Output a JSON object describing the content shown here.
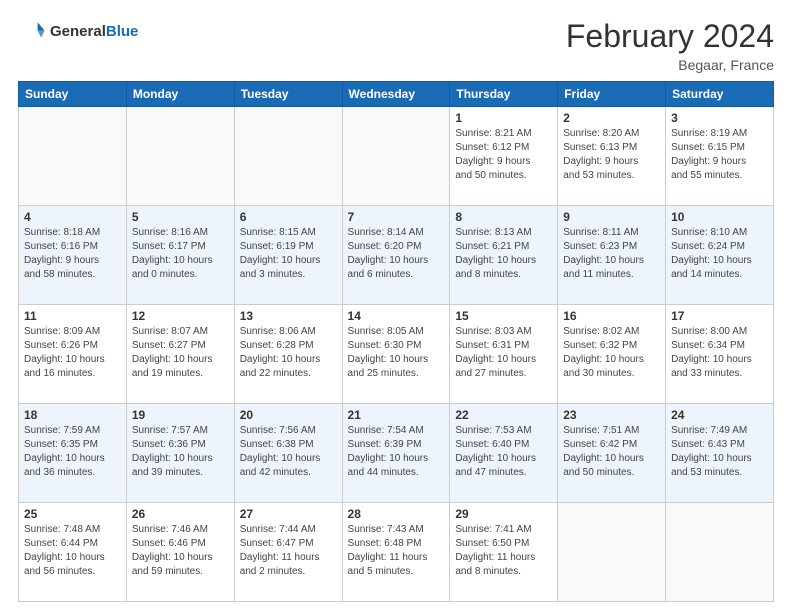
{
  "header": {
    "logo_general": "General",
    "logo_blue": "Blue",
    "month_title": "February 2024",
    "location": "Begaar, France"
  },
  "days_of_week": [
    "Sunday",
    "Monday",
    "Tuesday",
    "Wednesday",
    "Thursday",
    "Friday",
    "Saturday"
  ],
  "weeks": [
    [
      {
        "day": "",
        "info": ""
      },
      {
        "day": "",
        "info": ""
      },
      {
        "day": "",
        "info": ""
      },
      {
        "day": "",
        "info": ""
      },
      {
        "day": "1",
        "info": "Sunrise: 8:21 AM\nSunset: 6:12 PM\nDaylight: 9 hours\nand 50 minutes."
      },
      {
        "day": "2",
        "info": "Sunrise: 8:20 AM\nSunset: 6:13 PM\nDaylight: 9 hours\nand 53 minutes."
      },
      {
        "day": "3",
        "info": "Sunrise: 8:19 AM\nSunset: 6:15 PM\nDaylight: 9 hours\nand 55 minutes."
      }
    ],
    [
      {
        "day": "4",
        "info": "Sunrise: 8:18 AM\nSunset: 6:16 PM\nDaylight: 9 hours\nand 58 minutes."
      },
      {
        "day": "5",
        "info": "Sunrise: 8:16 AM\nSunset: 6:17 PM\nDaylight: 10 hours\nand 0 minutes."
      },
      {
        "day": "6",
        "info": "Sunrise: 8:15 AM\nSunset: 6:19 PM\nDaylight: 10 hours\nand 3 minutes."
      },
      {
        "day": "7",
        "info": "Sunrise: 8:14 AM\nSunset: 6:20 PM\nDaylight: 10 hours\nand 6 minutes."
      },
      {
        "day": "8",
        "info": "Sunrise: 8:13 AM\nSunset: 6:21 PM\nDaylight: 10 hours\nand 8 minutes."
      },
      {
        "day": "9",
        "info": "Sunrise: 8:11 AM\nSunset: 6:23 PM\nDaylight: 10 hours\nand 11 minutes."
      },
      {
        "day": "10",
        "info": "Sunrise: 8:10 AM\nSunset: 6:24 PM\nDaylight: 10 hours\nand 14 minutes."
      }
    ],
    [
      {
        "day": "11",
        "info": "Sunrise: 8:09 AM\nSunset: 6:26 PM\nDaylight: 10 hours\nand 16 minutes."
      },
      {
        "day": "12",
        "info": "Sunrise: 8:07 AM\nSunset: 6:27 PM\nDaylight: 10 hours\nand 19 minutes."
      },
      {
        "day": "13",
        "info": "Sunrise: 8:06 AM\nSunset: 6:28 PM\nDaylight: 10 hours\nand 22 minutes."
      },
      {
        "day": "14",
        "info": "Sunrise: 8:05 AM\nSunset: 6:30 PM\nDaylight: 10 hours\nand 25 minutes."
      },
      {
        "day": "15",
        "info": "Sunrise: 8:03 AM\nSunset: 6:31 PM\nDaylight: 10 hours\nand 27 minutes."
      },
      {
        "day": "16",
        "info": "Sunrise: 8:02 AM\nSunset: 6:32 PM\nDaylight: 10 hours\nand 30 minutes."
      },
      {
        "day": "17",
        "info": "Sunrise: 8:00 AM\nSunset: 6:34 PM\nDaylight: 10 hours\nand 33 minutes."
      }
    ],
    [
      {
        "day": "18",
        "info": "Sunrise: 7:59 AM\nSunset: 6:35 PM\nDaylight: 10 hours\nand 36 minutes."
      },
      {
        "day": "19",
        "info": "Sunrise: 7:57 AM\nSunset: 6:36 PM\nDaylight: 10 hours\nand 39 minutes."
      },
      {
        "day": "20",
        "info": "Sunrise: 7:56 AM\nSunset: 6:38 PM\nDaylight: 10 hours\nand 42 minutes."
      },
      {
        "day": "21",
        "info": "Sunrise: 7:54 AM\nSunset: 6:39 PM\nDaylight: 10 hours\nand 44 minutes."
      },
      {
        "day": "22",
        "info": "Sunrise: 7:53 AM\nSunset: 6:40 PM\nDaylight: 10 hours\nand 47 minutes."
      },
      {
        "day": "23",
        "info": "Sunrise: 7:51 AM\nSunset: 6:42 PM\nDaylight: 10 hours\nand 50 minutes."
      },
      {
        "day": "24",
        "info": "Sunrise: 7:49 AM\nSunset: 6:43 PM\nDaylight: 10 hours\nand 53 minutes."
      }
    ],
    [
      {
        "day": "25",
        "info": "Sunrise: 7:48 AM\nSunset: 6:44 PM\nDaylight: 10 hours\nand 56 minutes."
      },
      {
        "day": "26",
        "info": "Sunrise: 7:46 AM\nSunset: 6:46 PM\nDaylight: 10 hours\nand 59 minutes."
      },
      {
        "day": "27",
        "info": "Sunrise: 7:44 AM\nSunset: 6:47 PM\nDaylight: 11 hours\nand 2 minutes."
      },
      {
        "day": "28",
        "info": "Sunrise: 7:43 AM\nSunset: 6:48 PM\nDaylight: 11 hours\nand 5 minutes."
      },
      {
        "day": "29",
        "info": "Sunrise: 7:41 AM\nSunset: 6:50 PM\nDaylight: 11 hours\nand 8 minutes."
      },
      {
        "day": "",
        "info": ""
      },
      {
        "day": "",
        "info": ""
      }
    ]
  ]
}
